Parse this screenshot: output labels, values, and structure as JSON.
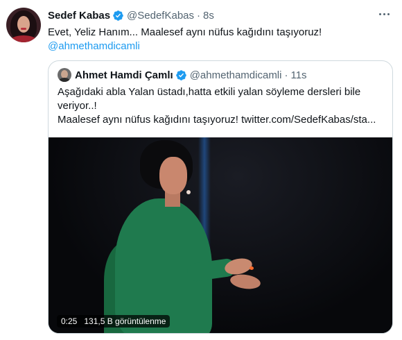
{
  "tweet": {
    "author_name": "Sedef Kabas",
    "author_handle": "@SedefKabas",
    "separator": "·",
    "time": "8s",
    "text_line1": "Evet, Yeliz Hanım... Maalesef aynı nüfus kağıdını taşıyoruz!",
    "mention": "@ahmethamdicamli",
    "icons": {
      "verified": "verified-badge-icon",
      "more": "more-options-icon"
    }
  },
  "quoted": {
    "author_name": "Ahmet Hamdi Çamlı",
    "author_handle": "@ahmethamdicamli",
    "separator": "·",
    "time": "11s",
    "text_line1": "Aşağıdaki abla Yalan üstadı,hatta etkili yalan söyleme dersleri bile",
    "text_line2": "veriyor..!",
    "text_line3": "Maalesef aynı nüfus kağıdını taşıyoruz!  twitter.com/SedefKabas/sta...",
    "video": {
      "duration": "0:25",
      "views": "131,5 B görüntülenme"
    }
  },
  "colors": {
    "accent": "#1d9bf0",
    "text": "#0f1419",
    "secondary": "#536471",
    "border": "#cfd9de",
    "dress_green": "#1f7a4e"
  }
}
